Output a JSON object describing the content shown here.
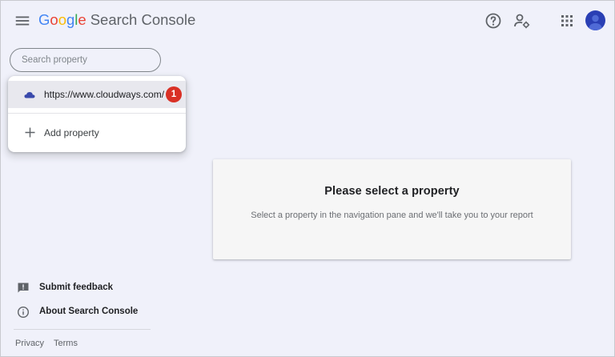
{
  "header": {
    "logo_letters": [
      "G",
      "o",
      "o",
      "g",
      "l",
      "e"
    ],
    "product_name": "Search Console",
    "icons": [
      "menu-icon",
      "help-icon",
      "manage-account-icon",
      "apps-grid-icon",
      "avatar"
    ]
  },
  "search": {
    "placeholder": "Search property"
  },
  "dropdown": {
    "property_url": "https://www.cloudways.com/",
    "property_badge": "1",
    "add_label": "Add property"
  },
  "card": {
    "title": "Please select a property",
    "subtitle": "Select a property in the navigation pane and we'll take you to your report"
  },
  "footer": {
    "feedback_label": "Submit feedback",
    "about_label": "About Search Console",
    "privacy": "Privacy",
    "terms": "Terms"
  },
  "colors": {
    "background": "#f0f1fa",
    "badge": "#d93025",
    "avatar": "#2a3fb4",
    "property_icon": "#3949ab"
  }
}
